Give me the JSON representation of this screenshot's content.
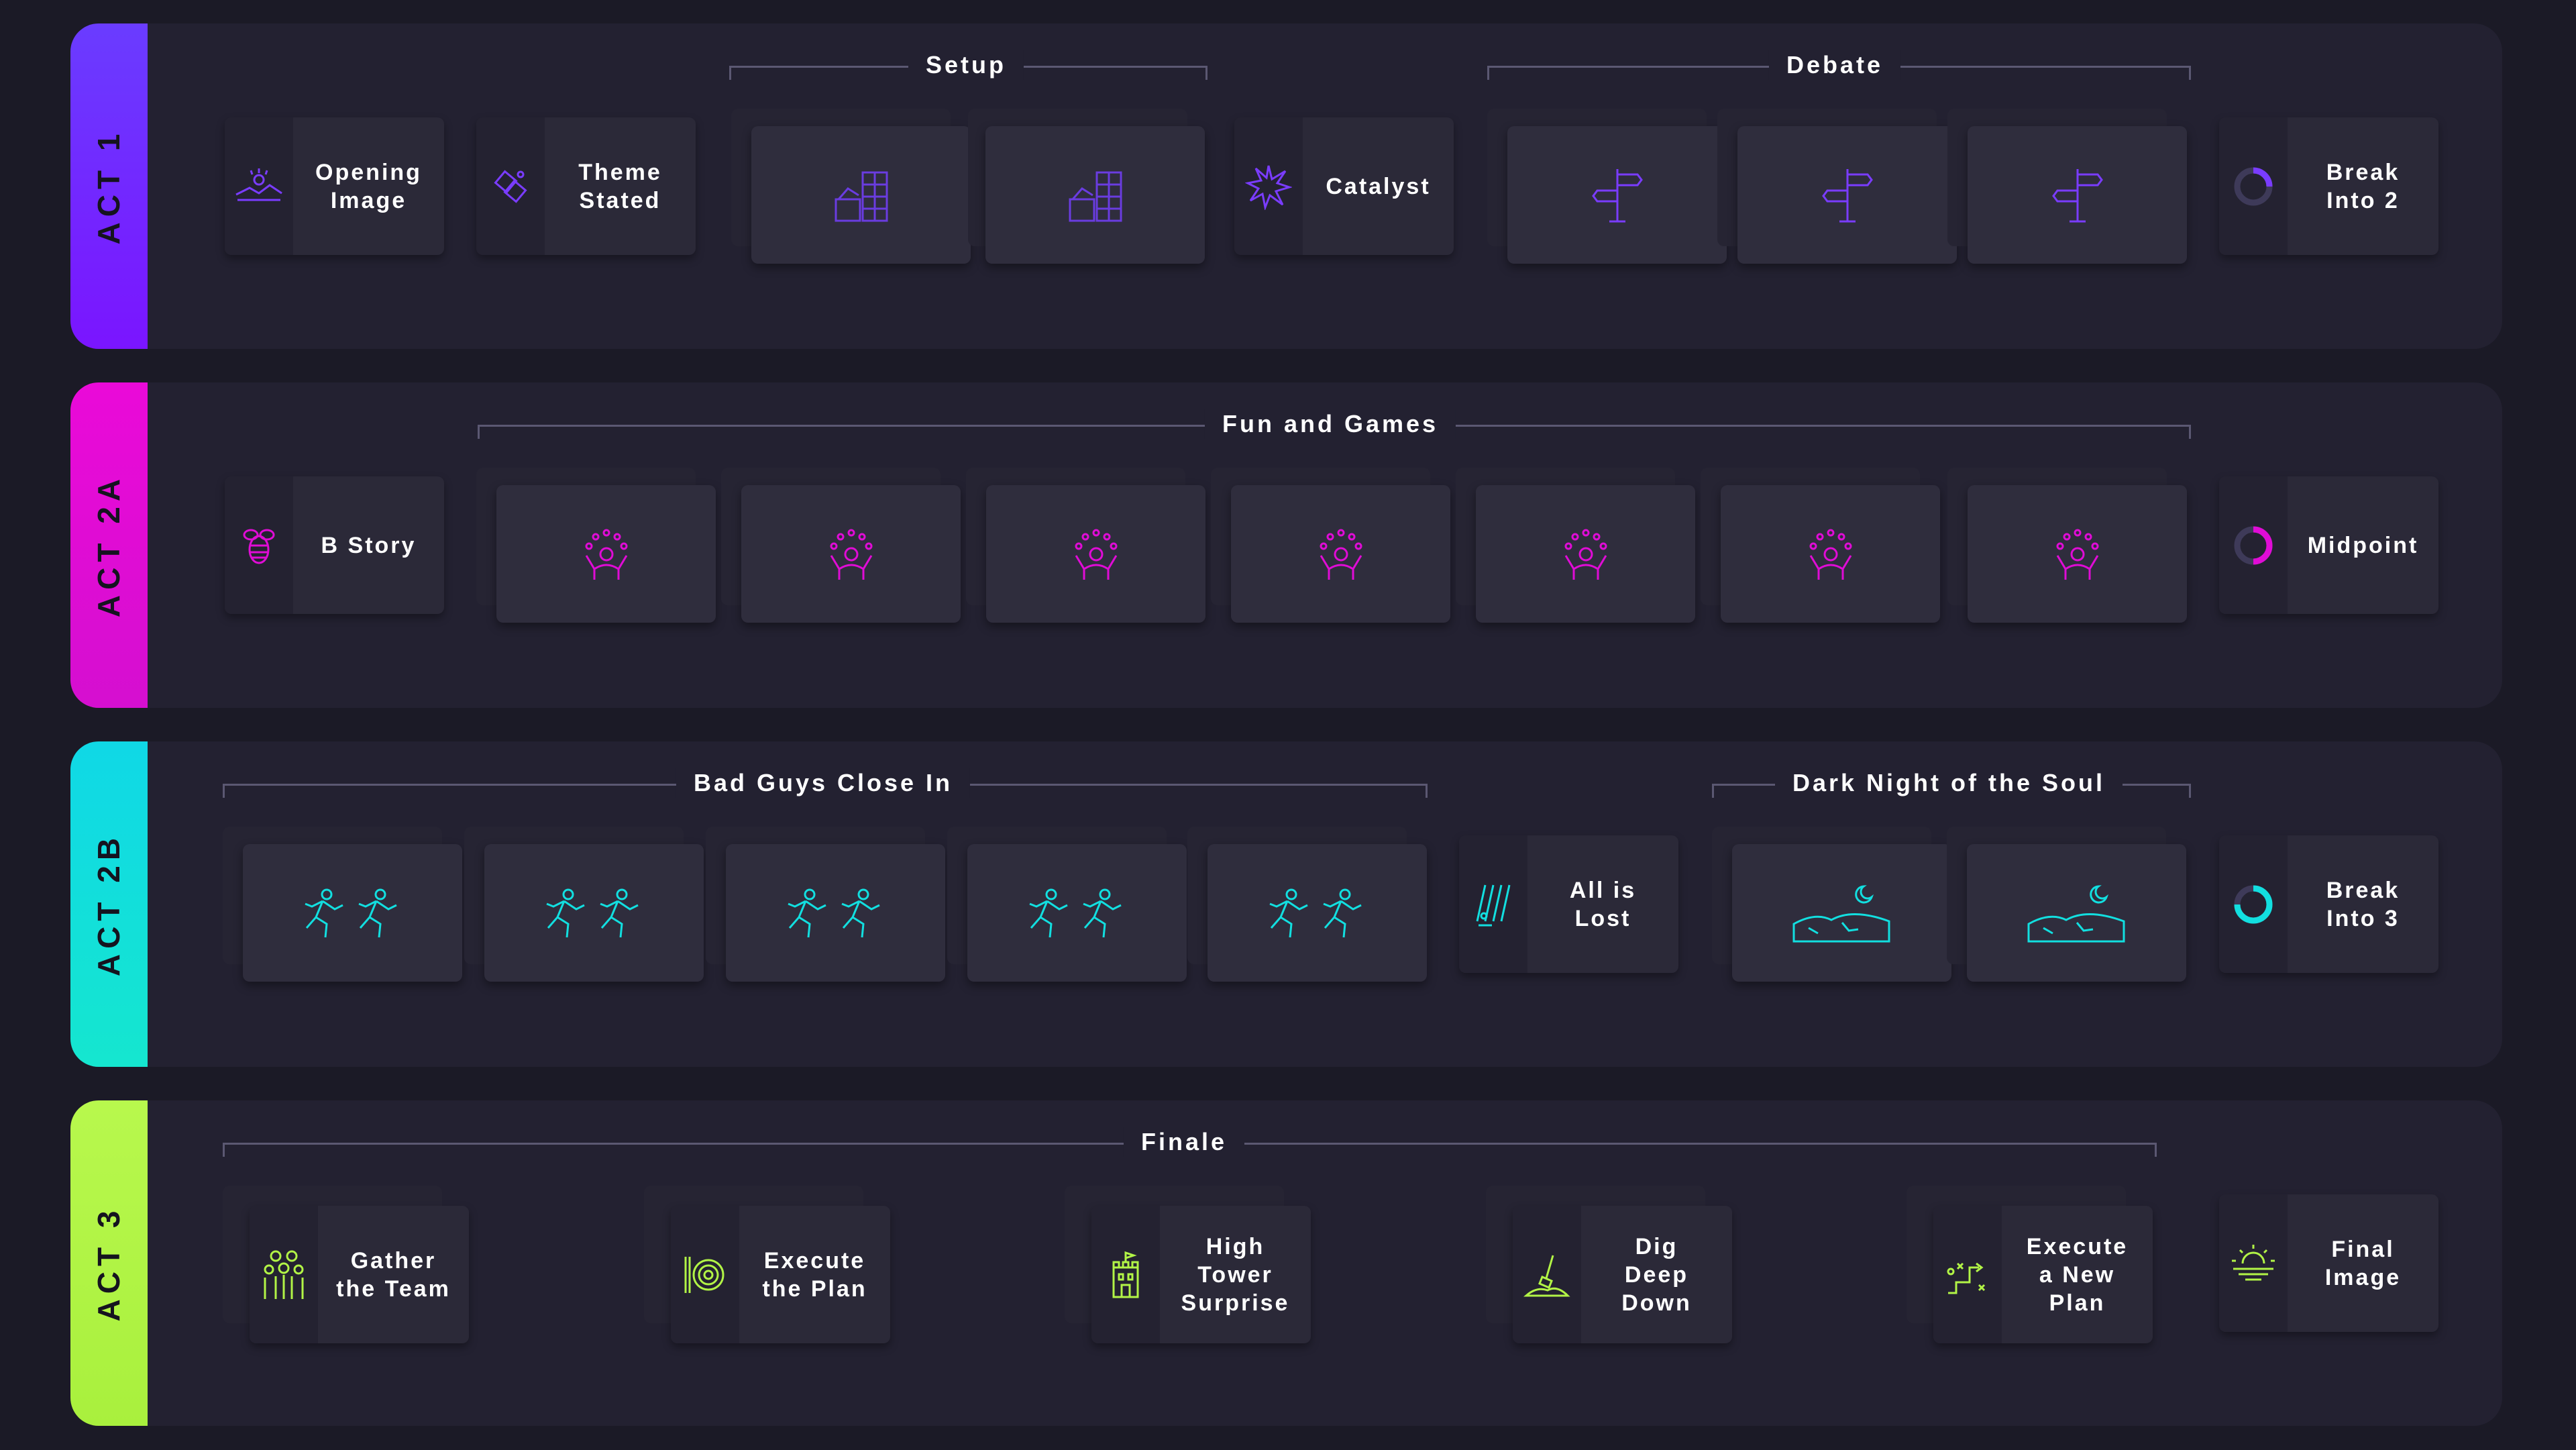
{
  "acts": [
    {
      "label": "ACT 1",
      "color": "#7a15ff"
    },
    {
      "label": "ACT 2A",
      "color": "#e00cd6"
    },
    {
      "label": "ACT 2B",
      "color": "#12dfe0"
    },
    {
      "label": "ACT 3",
      "color": "#b2f446"
    }
  ],
  "act1": {
    "brackets": {
      "setup": "Setup",
      "debate": "Debate"
    },
    "beats": {
      "opening_image": "Opening\nImage",
      "theme_stated": "Theme\nStated",
      "catalyst": "Catalyst",
      "break_into_2": "Break\nInto 2"
    },
    "icons": {
      "opening_image": "sunrise-landscape-icon",
      "theme_stated": "puzzle-pieces-icon",
      "setup": "building-blocks-icon",
      "catalyst": "explosion-burst-icon",
      "debate": "signpost-icon",
      "break_into_2": "quarter-ring-icon"
    }
  },
  "act2a": {
    "brackets": {
      "fun_and_games": "Fun and Games"
    },
    "beats": {
      "b_story": "B Story",
      "midpoint": "Midpoint"
    },
    "icons": {
      "b_story": "bee-icon",
      "fun_and_games": "juggler-icon",
      "midpoint": "half-ring-icon"
    }
  },
  "act2b": {
    "brackets": {
      "bad_guys_close_in": "Bad Guys Close In",
      "dark_night": "Dark Night of the Soul"
    },
    "beats": {
      "all_is_lost": "All is\nLost",
      "break_into_3": "Break\nInto 3"
    },
    "icons": {
      "bad_guys_close_in": "running-chase-icon",
      "all_is_lost": "rain-figure-icon",
      "dark_night": "moon-desert-icon",
      "break_into_3": "three-quarter-ring-icon"
    }
  },
  "act3": {
    "brackets": {
      "finale": "Finale"
    },
    "beats": {
      "gather_the_team": "Gather\nthe Team",
      "execute_the_plan": "Execute\nthe Plan",
      "high_tower_surprise": "High\nTower\nSurprise",
      "dig_deep_down": "Dig\nDeep\nDown",
      "execute_new_plan": "Execute\na New\nPlan",
      "final_image": "Final\nImage"
    },
    "icons": {
      "gather_the_team": "team-group-icon",
      "execute_the_plan": "target-dart-icon",
      "high_tower_surprise": "castle-tower-icon",
      "dig_deep_down": "shovel-dig-icon",
      "execute_new_plan": "strategy-play-icon",
      "final_image": "sunset-island-icon"
    }
  }
}
